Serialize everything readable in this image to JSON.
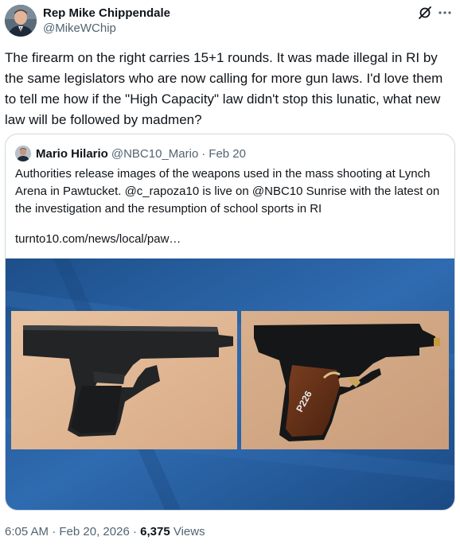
{
  "author": {
    "display_name": "Rep Mike Chippendale",
    "handle": "@MikeWChip"
  },
  "icons": {
    "grok": "grok-slash-icon",
    "more": "more-options-icon"
  },
  "tweet": {
    "text": "The firearm on the right carries 15+1 rounds. It was made illegal in RI by the same legislators who are now calling for more gun laws. I'd love them to tell me how if the \"High Capacity\" law didn't stop this lunatic, what new law will be followed by madmen?"
  },
  "quoted": {
    "display_name": "Mario Hilario",
    "handle": "@NBC10_Mario",
    "separator": "·",
    "date": "Feb 20",
    "text": "Authorities release images of the weapons used in the mass shooting at Lynch Arena in Pawtucket. @c_rapoza10 is live on @NBC10 Sunrise with the latest on the investigation and the resumption of school sports in RI",
    "link": "turnto10.com/news/local/paw…",
    "media_description": "two handguns on tan backgrounds over blue backdrop",
    "gun_grip_text": "P226"
  },
  "footer": {
    "time": "6:05 AM",
    "sep1": " · ",
    "date": "Feb 20, 2026",
    "sep2": " · ",
    "views_count": "6,375",
    "views_label": " Views"
  },
  "colors": {
    "secondary_text": "#536471",
    "border": "#cfd9de",
    "backdrop_blue": "#2a5f9e"
  }
}
